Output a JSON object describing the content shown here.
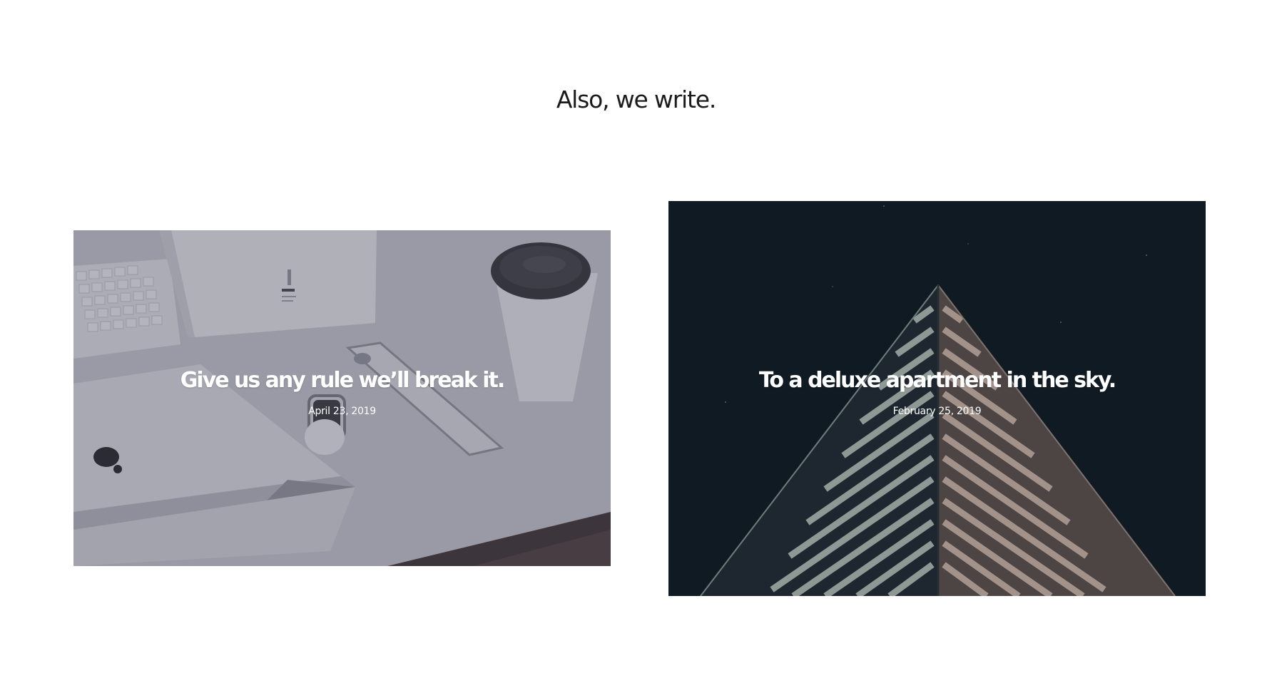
{
  "section": {
    "title": "Also, we write."
  },
  "posts": [
    {
      "title": "Give us any rule we’ll break it.",
      "date": "April 23, 2019",
      "image": "desk-workspace-photo"
    },
    {
      "title": "To a deluxe apartment in the sky.",
      "date": "February 25, 2019",
      "image": "skyscraper-photo"
    }
  ],
  "colors": {
    "background": "#ffffff",
    "heading": "#1b1b1b",
    "card_text": "#ffffff",
    "desk_overlay": "#9a9aa4",
    "sky_background": "#111b24"
  }
}
